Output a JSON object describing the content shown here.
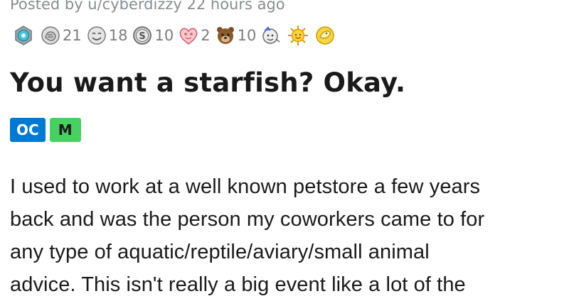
{
  "post": {
    "meta": "Posted by u/cyberdizzy 22 hours ago",
    "awards": [
      {
        "icon": "silver-award-icon",
        "count": ""
      },
      {
        "icon": "helpful-award-icon",
        "count": "21"
      },
      {
        "icon": "wholesome-award-icon",
        "count": "18"
      },
      {
        "icon": "silver-coin-award-icon",
        "count": "10"
      },
      {
        "icon": "heart-eyes-award-icon",
        "count": "2"
      },
      {
        "icon": "bear-award-icon",
        "count": "10"
      },
      {
        "icon": "hugz-award-icon",
        "count": ""
      },
      {
        "icon": "sun-award-icon",
        "count": ""
      },
      {
        "icon": "gold-award-icon",
        "count": ""
      }
    ],
    "title": "You want a starfish? Okay.",
    "flairs": {
      "oc": "OC",
      "m": "M"
    },
    "body_lines": [
      "I used to work at a well known petstore a few years",
      "back and was the person my coworkers came to for",
      "any type of aquatic/reptile/aviary/small animal",
      "advice. This isn't really a big event like a lot of the"
    ],
    "colors": {
      "meta_text": "#8a8c8e",
      "title_text": "#1a1a1b",
      "oc_flair": "#0079d3",
      "m_flair": "#46d160"
    }
  }
}
